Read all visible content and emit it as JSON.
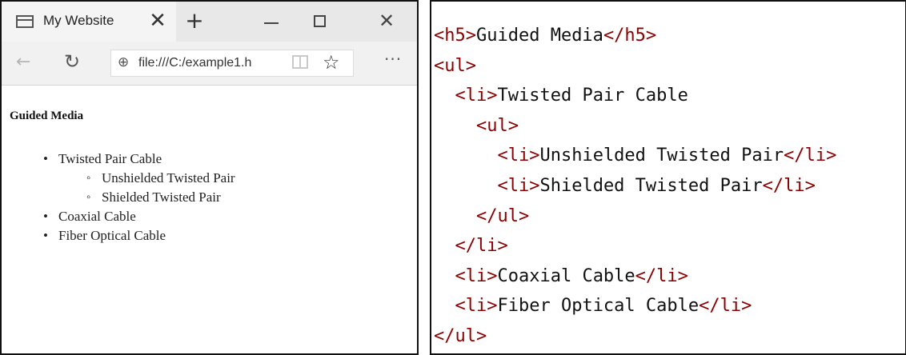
{
  "browser": {
    "tab_title": "My Website",
    "tab_close": "✕",
    "new_tab": "+",
    "window_close": "✕",
    "back": "←",
    "refresh": "↻",
    "url": "file:///C:/example1.h",
    "favorite": "☆",
    "more": "···"
  },
  "page": {
    "heading": "Guided Media",
    "list": [
      "Twisted Pair Cable",
      "Unshielded Twisted Pair",
      "Shielded Twisted Pair",
      "Coaxial Cable",
      "Fiber Optical Cable"
    ]
  },
  "code": {
    "tags": {
      "h5_open": "<h5>",
      "h5_close": "</h5>",
      "ul_open": "<ul>",
      "ul_close": "</ul>",
      "li_open": "<li>",
      "li_close": "</li>"
    },
    "indent1": "  ",
    "indent2": "    ",
    "indent3": "      ",
    "heading_text": "Guided Media",
    "items": [
      "Twisted Pair Cable",
      "Unshielded Twisted Pair",
      "Shielded Twisted Pair",
      "Coaxial Cable",
      "Fiber Optical Cable"
    ]
  },
  "colors": {
    "tag": "#8b0000",
    "text": "#111111",
    "border": "#111111"
  }
}
